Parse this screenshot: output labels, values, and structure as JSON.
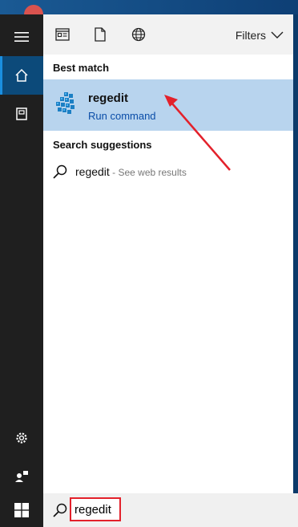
{
  "toolbar": {
    "filters_label": "Filters",
    "icons": [
      "apps-icon",
      "documents-icon",
      "web-icon",
      "chevron-down-icon"
    ]
  },
  "best_match": {
    "title": "Best match",
    "app_name": "regedit",
    "app_subtitle": "Run command",
    "icon": "registry-editor-icon"
  },
  "suggestions": {
    "title": "Search suggestions",
    "items": [
      {
        "query": "regedit",
        "hint": " - See web results",
        "icon": "search-icon"
      }
    ]
  },
  "rail": {
    "icons": [
      "hamburger-menu-icon",
      "home-icon",
      "notebook-icon",
      "settings-icon",
      "feedback-icon"
    ]
  },
  "taskbar": {
    "start_icon": "windows-logo-icon",
    "search_value": "regedit"
  },
  "colors": {
    "highlight": "#b8d4ee",
    "accent_link": "#0a4da8",
    "annotation": "#e3212b",
    "rail": "#1f1f1f"
  }
}
